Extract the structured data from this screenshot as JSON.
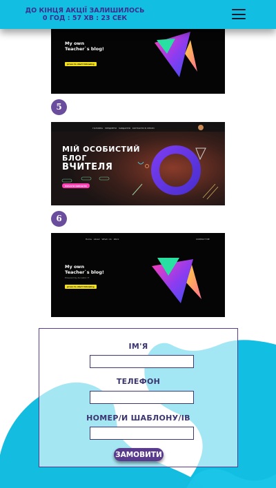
{
  "header": {
    "promo_line1": "ДО КІНЦЯ АКЦІЇ ЗАЛИШИЛОСЬ",
    "promo_line2": "0 ГОД : 57 ХВ : 23 СЕК"
  },
  "templates": [
    {
      "badge": "",
      "title_lines": [
        "My own",
        "Teacher`s blog!"
      ],
      "cta": "press to start following"
    },
    {
      "badge": "5",
      "nav": [
        "ГОЛОВНА",
        "ПРЕДМЕТИ",
        "ЗАВДАННЯ",
        "КОНТАКТИ ЗІ МНОЮ"
      ],
      "title_lines": [
        "МІЙ ОСОБИСТИЙ",
        "БЛОГ",
        "ВЧИТЕЛЯ"
      ],
      "cta": "ПОЧАТИ ВИВЧАТИ"
    },
    {
      "badge": "6",
      "nav": [
        "Home",
        "About",
        "What i do",
        "Work"
      ],
      "nav_right": "CONTACT ME",
      "title_lines": [
        "My own",
        "Teacher`s blog!"
      ],
      "sub": "Powered by Ancestor IT",
      "cta": "press to start following"
    }
  ],
  "form": {
    "name_label": "ІМ'Я",
    "phone_label": "ТЕЛЕФОН",
    "template_label": "НОМЕР/И ШАБЛОНУ/ІВ",
    "name_value": "",
    "phone_value": "",
    "template_value": "",
    "submit_label": "ЗАМОВИТИ"
  },
  "colors": {
    "header_bg": "#12bfe3",
    "accent_purple": "#5a3a8c",
    "badge": "#6a4d9c",
    "wave": "#12bfe3"
  }
}
